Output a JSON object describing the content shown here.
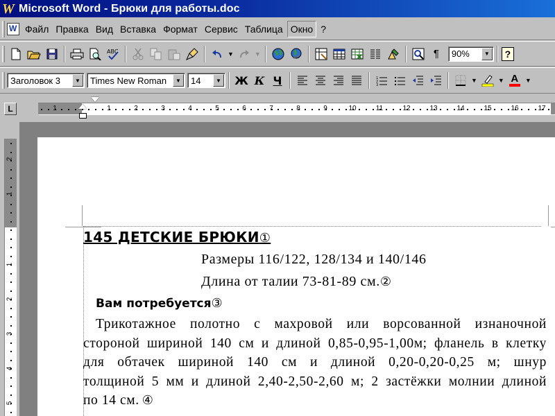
{
  "window": {
    "title": "Microsoft Word - Брюки для работы.doc",
    "app_icon": "word-icon"
  },
  "menu": {
    "items": [
      "Файл",
      "Правка",
      "Вид",
      "Вставка",
      "Формат",
      "Сервис",
      "Таблица",
      "Окно",
      "?"
    ],
    "active": "Окно"
  },
  "standard_toolbar": {
    "buttons": [
      "new-icon",
      "open-icon",
      "save-icon",
      "print-icon",
      "print-preview-icon",
      "spellcheck-icon",
      "cut-icon",
      "copy-icon",
      "paste-icon",
      "format-painter-icon",
      "undo-icon",
      "redo-icon",
      "web-toolbar-icon",
      "hyperlink-icon",
      "tables-borders-icon",
      "insert-table-icon",
      "insert-excel-icon",
      "columns-icon",
      "drawing-icon",
      "document-map-icon",
      "show-hide-icon",
      "help-icon"
    ],
    "zoom": "90%",
    "help_label": "?",
    "show_hide_label": "¶"
  },
  "format_toolbar": {
    "style": "Заголовок 3",
    "font": "Times New Roman",
    "size": "14",
    "bold_label": "Ж",
    "italic_label": "К",
    "underline_label": "Ч",
    "font_color_label": "А",
    "colors": {
      "highlight": "#ffff00",
      "font_color": "#ff0000"
    }
  },
  "ruler": {
    "tab_selector": "L",
    "numbers": [
      "1",
      "1",
      "2",
      "3",
      "4",
      "5",
      "6",
      "7",
      "8",
      "9",
      "10",
      "11",
      "12",
      "13",
      "14",
      "15",
      "16",
      "17"
    ],
    "v_numbers": [
      "2",
      "1",
      "1",
      "2",
      "3",
      "4",
      "5"
    ]
  },
  "document": {
    "heading": "145 ДЕТСКИЕ БРЮКИ",
    "heading_mark": "①",
    "sizes_line": "Размеры 116/122, 128/134 и 140/146",
    "length_line": "Длина от талии 73-81-89 см.",
    "length_mark": "②",
    "need_heading": "Вам потребуется",
    "need_mark": "③",
    "body_lines": [
      [
        "Трикотажное",
        "полотно",
        "с",
        "махровой",
        "или",
        "ворсованной",
        "изнаночной"
      ],
      [
        "стороной",
        "шириной",
        "140",
        "см",
        "и",
        "длиной",
        "0,85-0,95-1,00м;",
        "фланель",
        "в",
        "клетку"
      ],
      [
        "для",
        "обтачек",
        "шириной",
        "140",
        "см",
        "и",
        "длиной",
        "0,20-0,20-0,25",
        "м;",
        "шнур"
      ],
      [
        "толщиной",
        "5",
        "мм",
        "и",
        "длиной",
        "2,40-2,50-2,60",
        "м;",
        "2",
        "застёжки",
        "молнии",
        "длиной"
      ]
    ],
    "last_line": "по 14 см.",
    "last_mark": "④"
  }
}
